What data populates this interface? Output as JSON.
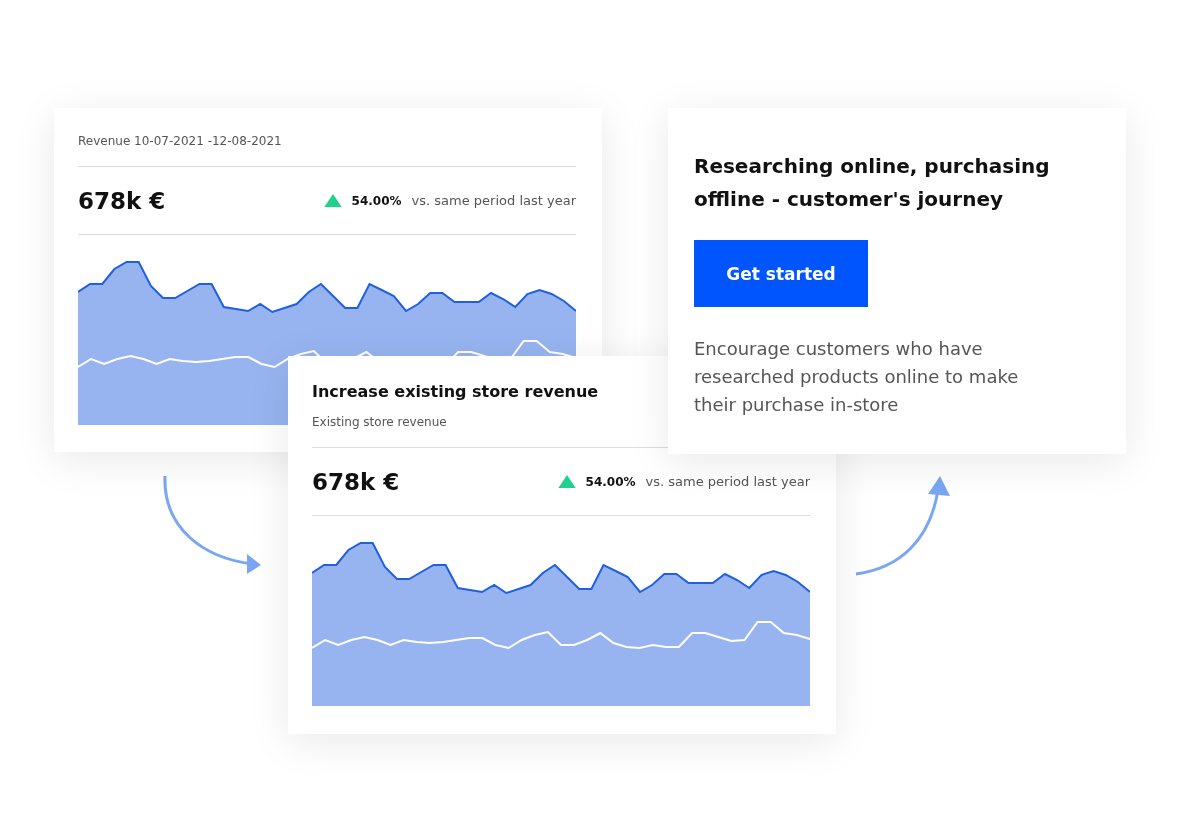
{
  "revenue_card": {
    "period_label": "Revenue 10-07-2021 -12-08-2021",
    "value": "678k €",
    "change": "54.00%",
    "comparison": "vs. same period last year"
  },
  "store_card": {
    "title": "Increase existing store revenue",
    "subtitle": "Existing store revenue",
    "value": "678k €",
    "change": "54.00%",
    "comparison": "vs. same period last year"
  },
  "journey_card": {
    "title": "Researching online, purchasing offline - customer's journey",
    "button": "Get started",
    "description": "Encourage customers who have researched products online to make their purchase in-store"
  }
}
